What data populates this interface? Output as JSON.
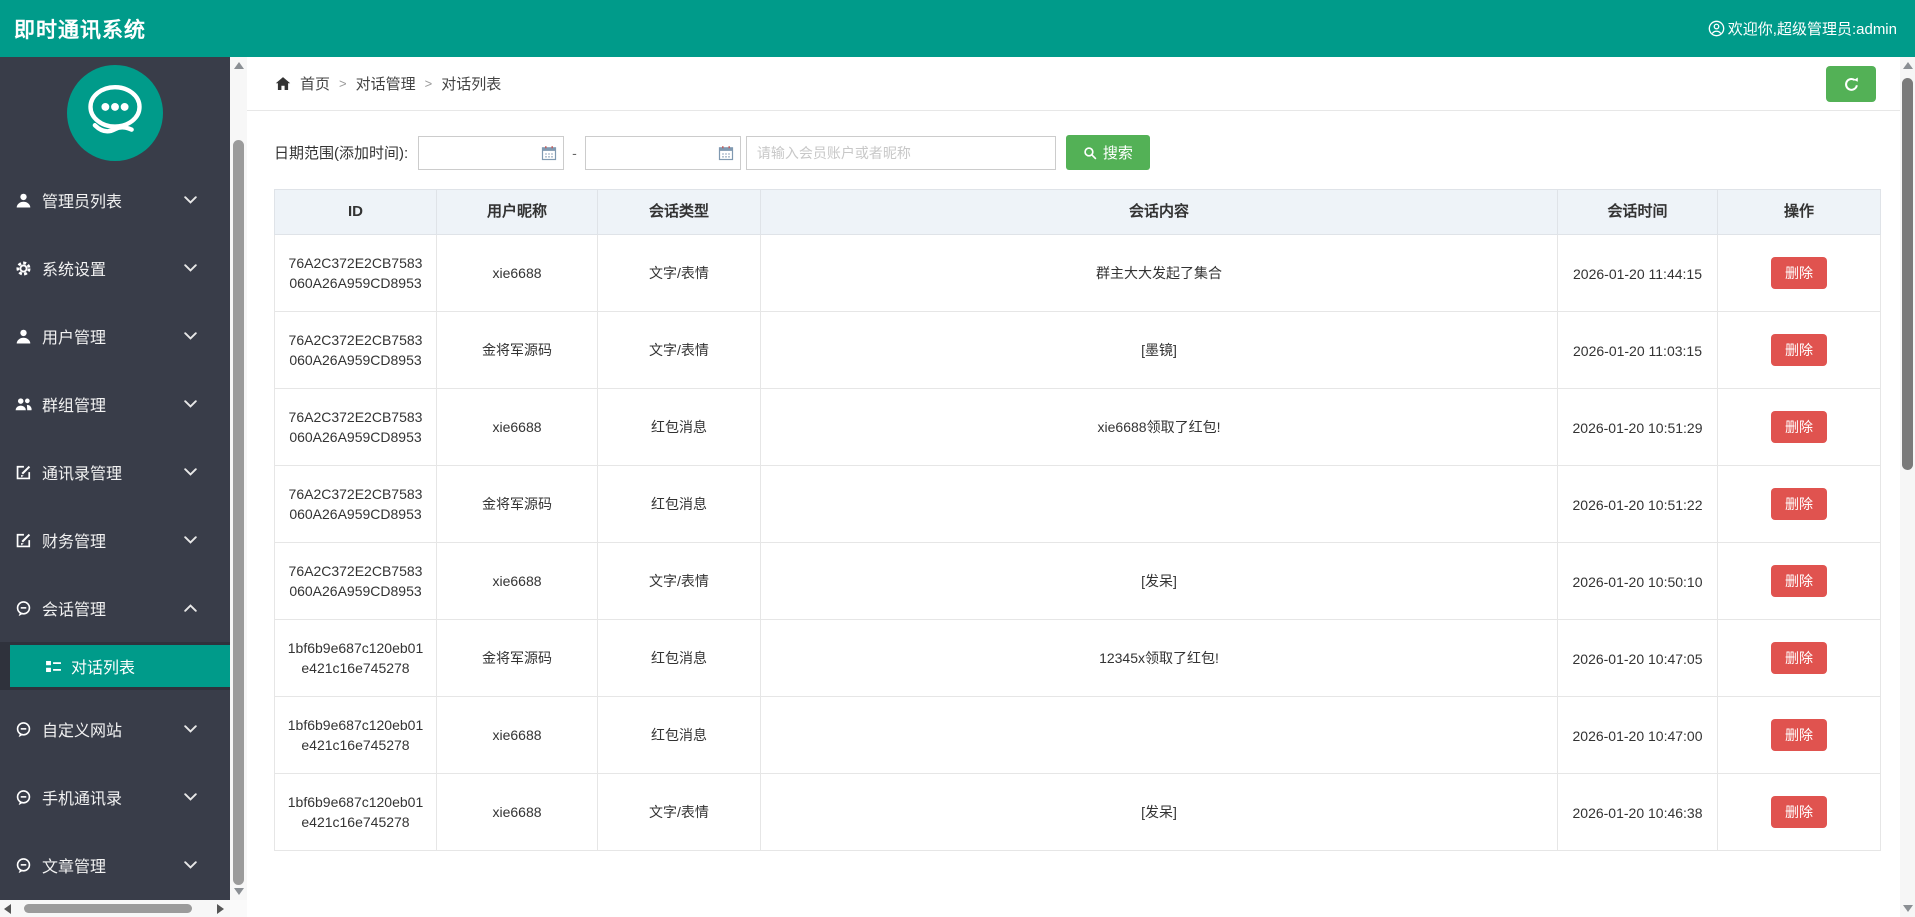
{
  "header": {
    "app_title": "即时通讯系统",
    "welcome_text": "欢迎你,超级管理员:admin"
  },
  "sidebar": {
    "items": [
      {
        "label": "管理员列表",
        "icon": "user-icon",
        "state": "collapsed"
      },
      {
        "label": "系统设置",
        "icon": "gear-icon",
        "state": "collapsed"
      },
      {
        "label": "用户管理",
        "icon": "user-icon",
        "state": "collapsed"
      },
      {
        "label": "群组管理",
        "icon": "users-icon",
        "state": "collapsed"
      },
      {
        "label": "通讯录管理",
        "icon": "edit-icon",
        "state": "collapsed"
      },
      {
        "label": "财务管理",
        "icon": "edit-icon",
        "state": "collapsed"
      },
      {
        "label": "会话管理",
        "icon": "comment-icon",
        "state": "expanded"
      },
      {
        "label": "自定义网站",
        "icon": "comment-icon",
        "state": "collapsed"
      },
      {
        "label": "手机通讯录",
        "icon": "comment-icon",
        "state": "collapsed"
      },
      {
        "label": "文章管理",
        "icon": "comment-icon",
        "state": "collapsed"
      }
    ],
    "active_submenu": {
      "label": "对话列表",
      "icon": "list-icon"
    }
  },
  "breadcrumb": {
    "home": "首页",
    "sep": ">",
    "level2": "对话管理",
    "level3": "对话列表"
  },
  "filters": {
    "date_label": "日期范围(添加时间):",
    "date_start": "",
    "date_end": "",
    "range_sep": "-",
    "keyword_placeholder": "请输入会员账户或者昵称",
    "search_label": "搜索"
  },
  "table": {
    "columns": [
      "ID",
      "用户昵称",
      "会话类型",
      "会话内容",
      "会话时间",
      "操作"
    ],
    "delete_label": "删除",
    "rows": [
      {
        "id": "76A2C372E2CB7583060A26A959CD8953",
        "nickname": "xie6688",
        "type": "文字/表情",
        "content": "群主大大发起了集合",
        "time": "2026-01-20 11:44:15"
      },
      {
        "id": "76A2C372E2CB7583060A26A959CD8953",
        "nickname": "金将军源码",
        "type": "文字/表情",
        "content": "[墨镜]",
        "time": "2026-01-20 11:03:15"
      },
      {
        "id": "76A2C372E2CB7583060A26A959CD8953",
        "nickname": "xie6688",
        "type": "红包消息",
        "content": "xie6688领取了红包!",
        "time": "2026-01-20 10:51:29"
      },
      {
        "id": "76A2C372E2CB7583060A26A959CD8953",
        "nickname": "金将军源码",
        "type": "红包消息",
        "content": "",
        "time": "2026-01-20 10:51:22"
      },
      {
        "id": "76A2C372E2CB7583060A26A959CD8953",
        "nickname": "xie6688",
        "type": "文字/表情",
        "content": "[发呆]",
        "time": "2026-01-20 10:50:10"
      },
      {
        "id": "1bf6b9e687c120eb01e421c16e745278",
        "nickname": "金将军源码",
        "type": "红包消息",
        "content": "12345x领取了红包!",
        "time": "2026-01-20 10:47:05"
      },
      {
        "id": "1bf6b9e687c120eb01e421c16e745278",
        "nickname": "xie6688",
        "type": "红包消息",
        "content": "",
        "time": "2026-01-20 10:47:00"
      },
      {
        "id": "1bf6b9e687c120eb01e421c16e745278",
        "nickname": "xie6688",
        "type": "文字/表情",
        "content": "[发呆]",
        "time": "2026-01-20 10:46:38"
      }
    ]
  },
  "colors": {
    "brand_teal": "#009b8a",
    "sidebar_bg": "#393d49",
    "button_green": "#53b156",
    "danger_red": "#e0534f",
    "table_header_bg": "#eef3f8"
  }
}
